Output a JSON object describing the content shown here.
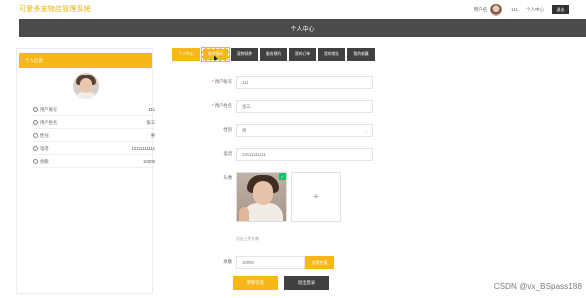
{
  "header": {
    "brand": "可爱多宠物店管理系统",
    "user_label": "用户名",
    "user_name": "111",
    "personal_center": "个人中心",
    "logout": "退出"
  },
  "page_title": "个人中心",
  "left_panel": {
    "heading": "个人信息",
    "rows": [
      {
        "label": "用户账号",
        "value": "111"
      },
      {
        "label": "用户姓名",
        "value": "张三"
      },
      {
        "label": "性别",
        "value": "男"
      },
      {
        "label": "电话",
        "value": "13111111111"
      },
      {
        "label": "余额",
        "value": "10000"
      }
    ]
  },
  "tabs": [
    {
      "label": "个人中心",
      "state": "active"
    },
    {
      "label": "修改密码",
      "state": "selected"
    },
    {
      "label": "宠物领养",
      "state": "normal"
    },
    {
      "label": "服务预约",
      "state": "normal"
    },
    {
      "label": "我的订单",
      "state": "normal"
    },
    {
      "label": "我的地址",
      "state": "normal"
    },
    {
      "label": "我的收藏",
      "state": "normal"
    }
  ],
  "form": {
    "account_label": "用户账号",
    "account_value": "111",
    "name_label": "用户姓名",
    "name_value": "张三",
    "gender_label": "性别",
    "gender_value": "男",
    "phone_label": "电话",
    "phone_value": "13111111111",
    "avatar_label": "头像",
    "upload_plus": "+",
    "upload_hint": "点击上传头像",
    "balance_label": "余额",
    "balance_value": "10000",
    "recharge_button": "点我充值",
    "update_button": "更新信息",
    "logout_button": "退出登录"
  },
  "watermark": "CSDN @vx_BSpass188",
  "colors": {
    "accent": "#f5b818",
    "dark": "#404040",
    "title_bar": "#4a4a4a"
  }
}
